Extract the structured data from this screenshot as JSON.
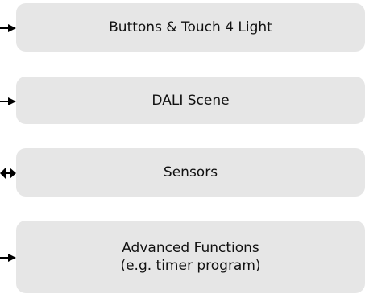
{
  "boxes": [
    {
      "lines": [
        "Buttons & Touch 4 Light"
      ]
    },
    {
      "lines": [
        "DALI Scene"
      ]
    },
    {
      "lines": [
        "Sensors"
      ]
    },
    {
      "lines": [
        "Advanced Functions",
        "(e.g. timer program)"
      ]
    }
  ],
  "colors": {
    "box_fill": "#e6e6e6",
    "text": "#111111",
    "arrow": "#000000"
  },
  "connectors": [
    "arrow-right",
    "arrow-right",
    "arrow-bidirectional",
    "arrow-right"
  ]
}
